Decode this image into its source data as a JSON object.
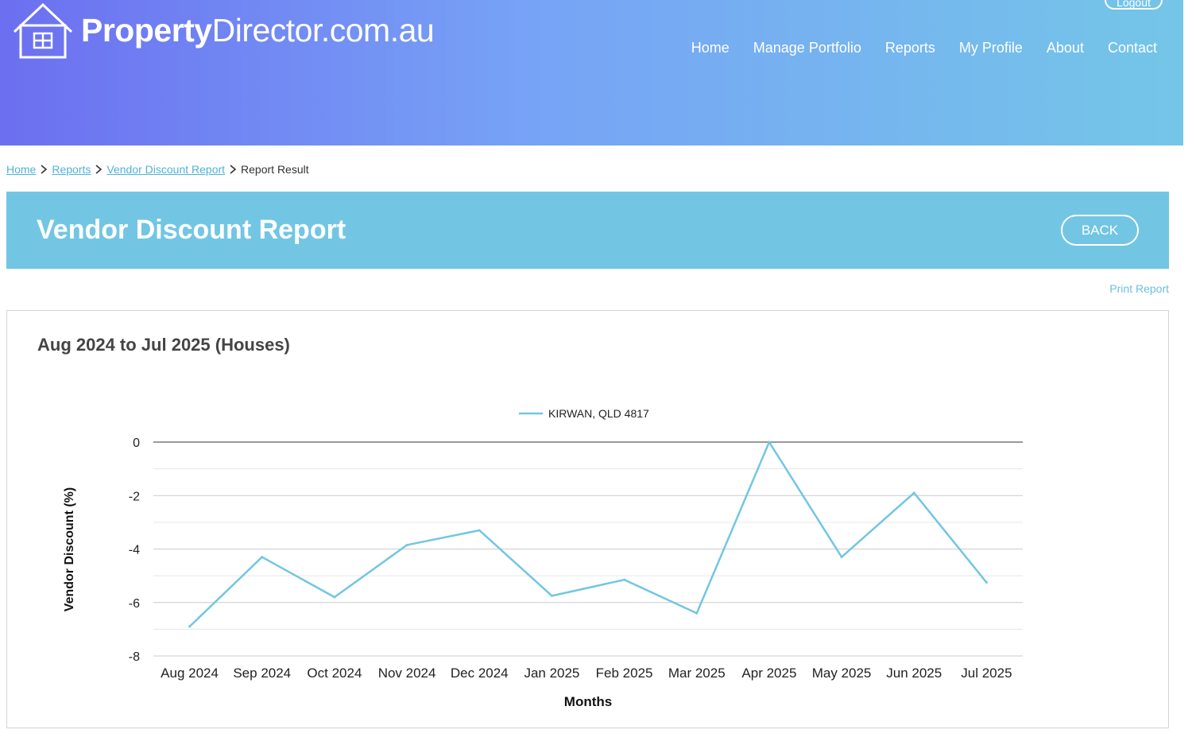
{
  "brand": {
    "name_bold": "Property",
    "name_rest": "Director.com.au"
  },
  "header": {
    "logout_label": "Logout"
  },
  "nav": [
    "Home",
    "Manage Portfolio",
    "Reports",
    "My Profile",
    "About",
    "Contact"
  ],
  "breadcrumb": {
    "items": [
      "Home",
      "Reports",
      "Vendor Discount Report"
    ],
    "current": "Report Result"
  },
  "banner": {
    "title": "Vendor Discount Report",
    "back_label": "BACK"
  },
  "print_label": "Print Report",
  "card": {
    "title": "Aug 2024 to Jul 2025 (Houses)"
  },
  "colors": {
    "series": "#72c6e3",
    "banner": "#72c6e3",
    "link": "#4fb3d6"
  },
  "chart_data": {
    "type": "line",
    "categories": [
      "Aug 2024",
      "Sep 2024",
      "Oct 2024",
      "Nov 2024",
      "Dec 2024",
      "Jan 2025",
      "Feb 2025",
      "Mar 2025",
      "Apr 2025",
      "May 2025",
      "Jun 2025",
      "Jul 2025"
    ],
    "series": [
      {
        "name": "KIRWAN, QLD 4817",
        "values": [
          -6.9,
          -4.3,
          -5.8,
          -3.85,
          -3.3,
          -5.75,
          -5.15,
          -6.4,
          0,
          -4.3,
          -1.9,
          -5.25
        ]
      }
    ],
    "xlabel": "Months",
    "ylabel": "Vendor Discount (%)",
    "ylim": [
      -8,
      0
    ],
    "yticks": [
      "0",
      "-2",
      "-4",
      "-6",
      "-8"
    ],
    "grid": true,
    "legend": "top-center"
  }
}
